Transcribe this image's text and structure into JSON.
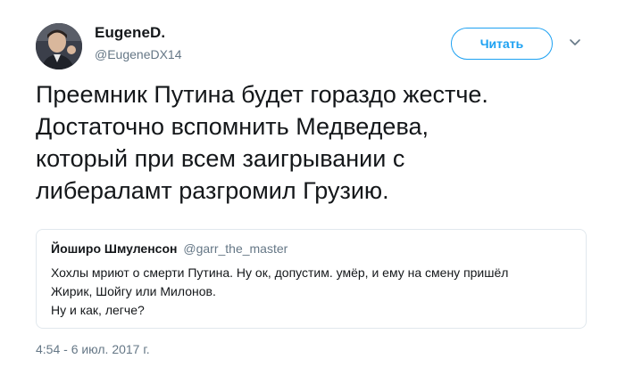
{
  "author": {
    "display_name": "EugeneD.",
    "handle": "@EugeneDX14"
  },
  "follow_button": {
    "label": "Читать"
  },
  "menu_caret": {
    "icon": "chevron-down-icon"
  },
  "tweet": {
    "lines": [
      "Преемник Путина будет гораздо жестче.",
      "Достаточно вспомнить Медведева,",
      "который при всем заигрывании с",
      "либераламт разгромил Грузию."
    ],
    "timestamp": "4:54 - 6 июл. 2017 г."
  },
  "quoted_tweet": {
    "display_name": "Йоширо Шмуленсон",
    "handle": "@garr_the_master",
    "lines": [
      "Хохлы мриют о смерти Путина. Ну ок, допустим. умёр, и ему на смену пришёл",
      "Жирик, Шойгу или Милонов.",
      "Ну и как, легче?"
    ]
  },
  "colors": {
    "accent": "#1da1f2",
    "text": "#14171a",
    "muted": "#657786",
    "border": "#e1e8ed"
  }
}
